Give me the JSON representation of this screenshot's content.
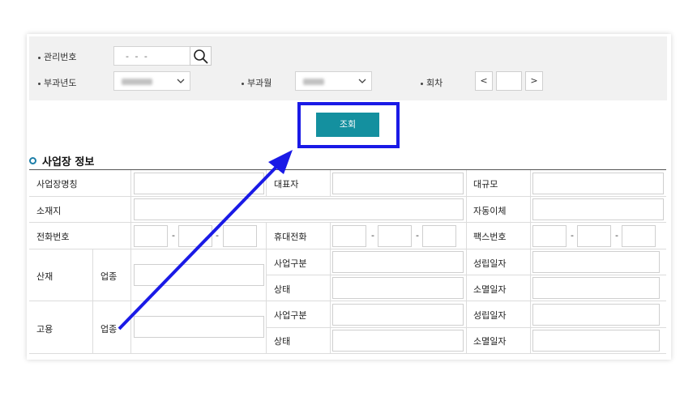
{
  "search": {
    "mgmt_label": "관리번호",
    "mgmt_value": "- - -",
    "year_label": "부과년도",
    "month_label": "부과월",
    "round_label": "회차",
    "prev": "<",
    "next": ">"
  },
  "actions": {
    "query_label": "조회"
  },
  "section": {
    "title": "사업장 정보"
  },
  "table": {
    "business_name": "사업장명칭",
    "representative": "대표자",
    "size": "대규모",
    "address": "소재지",
    "auto_transfer": "자동이체",
    "phone": "전화번호",
    "mobile": "휴대전화",
    "fax": "팩스번호",
    "industrial": "산재",
    "employment": "고용",
    "industry": "업종",
    "biz_type": "사업구분",
    "status": "상태",
    "est_date": "성립일자",
    "end_date": "소멸일자",
    "dash": "-"
  }
}
